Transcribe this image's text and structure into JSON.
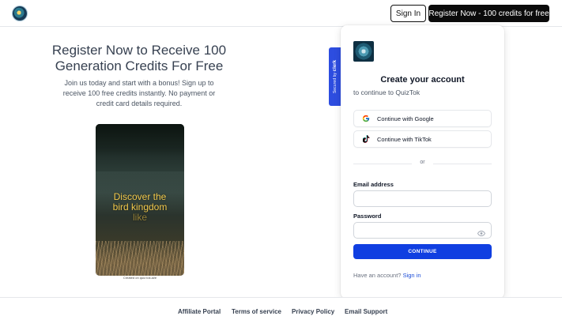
{
  "header": {
    "logo_icon": "globe-logo-icon",
    "signin_label": "Sign In",
    "register_label": "Register Now - 100 credits for free"
  },
  "promo": {
    "title": "Register Now to Receive 100 Generation Credits For Free",
    "text": "Join us today and start with a bonus! Sign up to receive 100 free credits instantly. No payment or credit card details required.",
    "video_caption_line1": "Discover the",
    "video_caption_line2": "bird kingdom",
    "video_caption_line3": "like",
    "video_credit": "Created on quiz.tok.ai/e"
  },
  "clerk_badge": {
    "secured_by": "Secured by",
    "brand": "clerk"
  },
  "auth": {
    "app_logo_icon": "quiztok-logo-icon",
    "title": "Create your account",
    "subtitle": "to continue to QuizTok",
    "google_label": "Continue with Google",
    "tiktok_label": "Continue with TikTok",
    "divider_text": "or",
    "email_label": "Email address",
    "email_value": "",
    "password_label": "Password",
    "password_value": "",
    "continue_label": "CONTINUE",
    "have_account_text": "Have an account?",
    "signin_link": "Sign in",
    "accent_color": "#103fe1"
  },
  "footer": {
    "links": [
      "Affiliate Portal",
      "Terms of service",
      "Privacy Policy",
      "Email Support"
    ]
  }
}
